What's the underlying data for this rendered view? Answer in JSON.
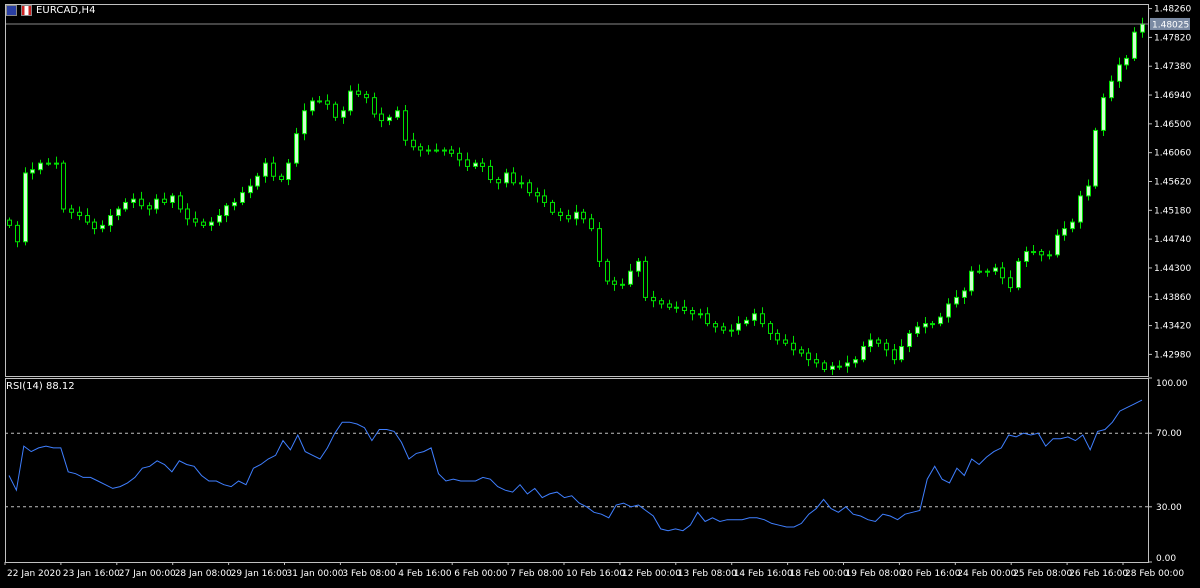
{
  "symbol": "EURCAD,H4",
  "icons": [
    "flag-eu-icon",
    "flag-ca-icon"
  ],
  "colors": {
    "background": "#000000",
    "frame": "#c0c0c0",
    "bull": "#cfffcf",
    "wick": "#00e000",
    "bear": "#000000",
    "rsi_line": "#3f7fff",
    "level_line": "#c0c0c0",
    "current_price_box": "#7a8aa3"
  },
  "rsi": {
    "label": "RSI(14)",
    "value": "88.12",
    "scale_labels": [
      "100.00",
      "70.00",
      "30.00",
      "0.00"
    ],
    "levels": [
      70,
      30
    ]
  },
  "price_axis": {
    "labels": [
      "1.48260",
      "1.47820",
      "1.47380",
      "1.46940",
      "1.46500",
      "1.46060",
      "1.45620",
      "1.45180",
      "1.44740",
      "1.44300",
      "1.43860",
      "1.43420",
      "1.42980"
    ],
    "current_price": "1.48025"
  },
  "time_axis": {
    "labels": [
      "22 Jan 2020",
      "23 Jan 16:00",
      "27 Jan 00:00",
      "28 Jan 08:00",
      "29 Jan 16:00",
      "31 Jan 00:00",
      "3 Feb 08:00",
      "4 Feb 16:00",
      "6 Feb 00:00",
      "7 Feb 08:00",
      "10 Feb 16:00",
      "12 Feb 00:00",
      "13 Feb 08:00",
      "14 Feb 16:00",
      "18 Feb 00:00",
      "19 Feb 08:00",
      "20 Feb 16:00",
      "24 Feb 00:00",
      "25 Feb 08:00",
      "26 Feb 16:00",
      "28 Feb 00:00"
    ]
  },
  "chart_data": [
    {
      "type": "candlestick",
      "title": "EURCAD,H4",
      "ylim": [
        1.4265,
        1.4833
      ],
      "series": [
        {
          "name": "EURCAD,H4",
          "close": [
            1.4495,
            1.447,
            1.4575,
            1.458,
            1.459,
            1.459,
            1.459,
            1.452,
            1.4515,
            1.451,
            1.45,
            1.449,
            1.4495,
            1.451,
            1.452,
            1.453,
            1.4535,
            1.4525,
            1.452,
            1.4535,
            1.453,
            1.454,
            1.452,
            1.4505,
            1.45,
            1.4495,
            1.45,
            1.451,
            1.4525,
            1.453,
            1.4545,
            1.4555,
            1.457,
            1.459,
            1.457,
            1.4565,
            1.459,
            1.4635,
            1.467,
            1.4685,
            1.4685,
            1.468,
            1.466,
            1.467,
            1.47,
            1.4695,
            1.469,
            1.4665,
            1.4655,
            1.466,
            1.467,
            1.4625,
            1.4615,
            1.461,
            1.461,
            1.461,
            1.461,
            1.4605,
            1.4595,
            1.4585,
            1.459,
            1.4585,
            1.4565,
            1.456,
            1.4575,
            1.456,
            1.456,
            1.4545,
            1.454,
            1.453,
            1.4515,
            1.451,
            1.4505,
            1.4515,
            1.4505,
            1.449,
            1.444,
            1.441,
            1.4405,
            1.4405,
            1.4425,
            1.444,
            1.4385,
            1.438,
            1.4375,
            1.437,
            1.437,
            1.4365,
            1.436,
            1.436,
            1.4345,
            1.434,
            1.4335,
            1.4335,
            1.4345,
            1.435,
            1.436,
            1.4345,
            1.433,
            1.432,
            1.4315,
            1.4305,
            1.43,
            1.429,
            1.4285,
            1.4275,
            1.428,
            1.428,
            1.4285,
            1.429,
            1.431,
            1.432,
            1.4315,
            1.4305,
            1.429,
            1.431,
            1.433,
            1.434,
            1.4345,
            1.4345,
            1.4355,
            1.4375,
            1.4385,
            1.4395,
            1.4425,
            1.4425,
            1.4425,
            1.443,
            1.4415,
            1.44,
            1.444,
            1.4455,
            1.4455,
            1.445,
            1.445,
            1.448,
            1.449,
            1.45,
            1.454,
            1.4555,
            1.464,
            1.469,
            1.4715,
            1.474,
            1.475,
            1.479,
            1.4802
          ]
        }
      ]
    },
    {
      "type": "line",
      "title": "RSI(14) 88.12",
      "ylim": [
        0,
        100
      ],
      "series": [
        {
          "name": "RSI(14)",
          "values": [
            47,
            39,
            63,
            60,
            62,
            63,
            62,
            62,
            49,
            48,
            46,
            46,
            44,
            42,
            40,
            41,
            43,
            46,
            51,
            52,
            55,
            53,
            49,
            55,
            53,
            52,
            47,
            44,
            44,
            42,
            41,
            44,
            42,
            51,
            53,
            56,
            58,
            66,
            61,
            69,
            60,
            58,
            56,
            62,
            70,
            76,
            76,
            75,
            73,
            66,
            72,
            72,
            71,
            65,
            56,
            59,
            60,
            62,
            48,
            44,
            45,
            44,
            44,
            44,
            46,
            45,
            41,
            39,
            38,
            42,
            37,
            40,
            35,
            37,
            38,
            35,
            36,
            32,
            30,
            27,
            26,
            24,
            31,
            32,
            30,
            31,
            28,
            25,
            18,
            17,
            18,
            17,
            20,
            27,
            22,
            24,
            22,
            23,
            23,
            23,
            24,
            24,
            23,
            21,
            20,
            19,
            19,
            21,
            26,
            29,
            34,
            29,
            27,
            30,
            26,
            25,
            23,
            22,
            26,
            25,
            23,
            26,
            27,
            28,
            45,
            52,
            45,
            43,
            51,
            47,
            56,
            53,
            57,
            60,
            62,
            69,
            68,
            70,
            69,
            70,
            63,
            67,
            67,
            68,
            66,
            69,
            61,
            71,
            72,
            76,
            82,
            84,
            86,
            88
          ]
        }
      ]
    }
  ]
}
